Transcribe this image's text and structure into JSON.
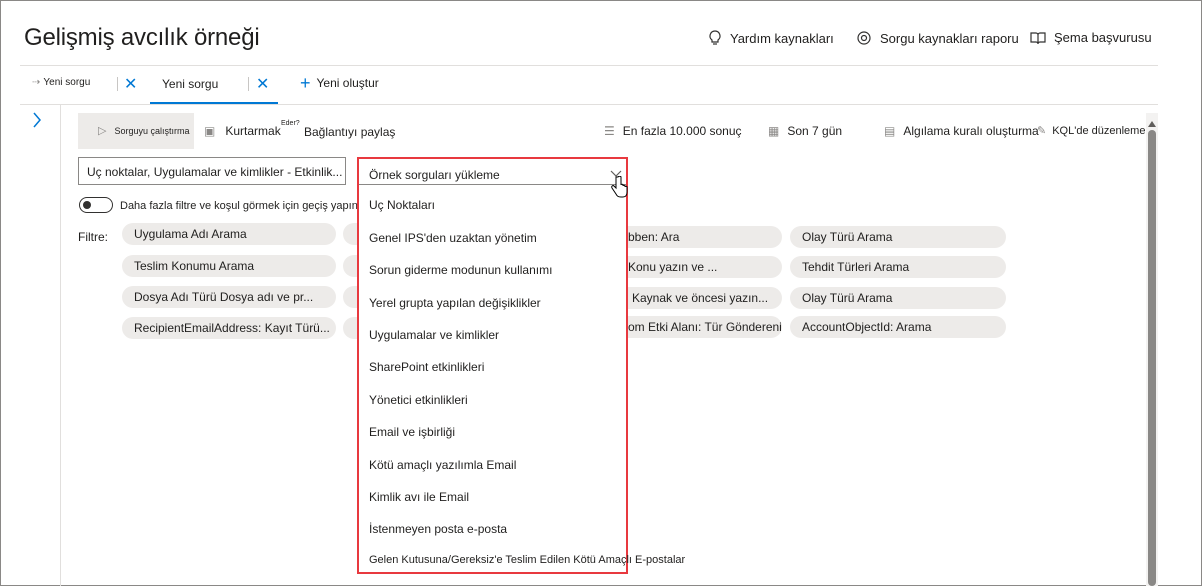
{
  "header": {
    "title": "Gelişmiş avcılık örneği",
    "links": [
      {
        "label": "Yardım kaynakları",
        "icon": "lightbulb-icon"
      },
      {
        "label": "Sorgu kaynakları raporu",
        "icon": "report-icon"
      },
      {
        "label": "Şema başvurusu",
        "icon": "book-icon"
      }
    ]
  },
  "tabs": {
    "items": [
      {
        "label": "Yeni sorgu"
      },
      {
        "label": "Yeni sorgu"
      }
    ],
    "new_label": "Yeni oluştur"
  },
  "toolbar": {
    "run_label": "Sorguyu çalıştırma",
    "save_label": "Kurtarmak",
    "edit_superscript": "Eder?",
    "share_label": "Bağlantıyı paylaş",
    "limit_label": "En fazla 10.000 sonuç",
    "time_label": "Son 7 gün",
    "detection_label": "Algılama kuralı oluşturma",
    "kql_label": "KQL'de düzenleme"
  },
  "filters": {
    "category_select": "Uç noktalar, Uygulamalar ve kimlikler - Etkinlik...",
    "toggle_label": "Daha fazla filtre ve koşul görmek için geçiş yapın",
    "filter_label": "Filtre:",
    "chips_col1": [
      "Uygulama Adı Arama",
      "Teslim Konumu Arama",
      "Dosya Adı Türü Dosya adı ve pr...",
      "RecipientEmailAddress: Kayıt Türü..."
    ],
    "chips_col3": [
      "bben: Ara",
      "Konu yazın ve ...",
      "Kaynak ve öncesi yazın...",
      "Etki Alanı: Tür Göndereni"
    ],
    "chips_col4": [
      "Olay Türü Arama",
      "Tehdit Türleri Arama",
      "Olay Türü Arama",
      "AccountObjectId: Arama"
    ],
    "partial_fragment": "om"
  },
  "dropdown": {
    "placeholder": "Örnek sorguları yükleme",
    "options": [
      "Uç Noktaları",
      "Genel IPS'den uzaktan yönetim",
      "Sorun giderme modunun kullanımı",
      "Yerel grupta yapılan değişiklikler",
      "Uygulamalar ve kimlikler",
      "SharePoint etkinlikleri",
      "Yönetici etkinlikleri",
      "Email ve işbirliği",
      "Kötü amaçlı yazılımla Email",
      "Kimlik avı ile Email",
      "İstenmeyen posta e-posta",
      "Gelen Kutusuna/Gereksiz'e Teslim Edilen Kötü Amaçlı E-postalar"
    ]
  },
  "colors": {
    "accent": "#0078d4",
    "highlight_border": "#e8393f",
    "chip_bg": "#edebe9"
  }
}
